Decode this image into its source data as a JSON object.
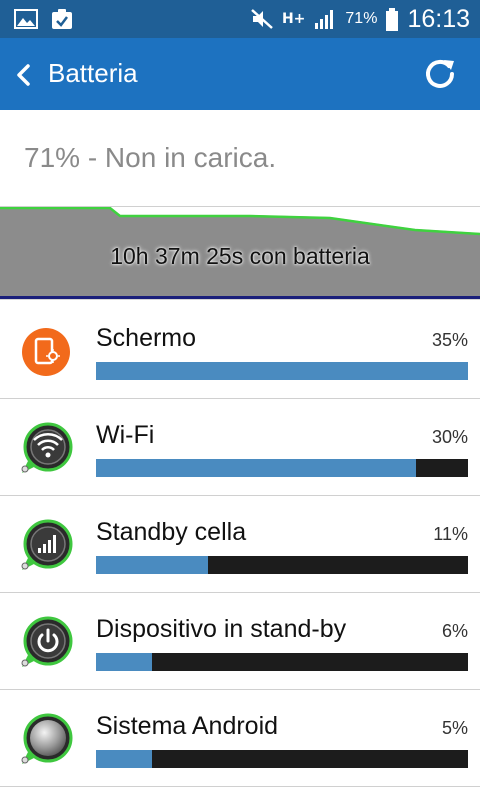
{
  "status_bar": {
    "battery_text": "71%",
    "time": "16:13",
    "network_type": "H+"
  },
  "header": {
    "title": "Batteria"
  },
  "battery": {
    "status_line": "71% - Non in carica.",
    "graph_label": "10h 37m 25s con batteria"
  },
  "usage": [
    {
      "name": "Schermo",
      "percent_label": "35%",
      "fill": 1.0,
      "icon": "screen-brightness-icon"
    },
    {
      "name": "Wi-Fi",
      "percent_label": "30%",
      "fill": 0.86,
      "icon": "wifi-icon"
    },
    {
      "name": "Standby cella",
      "percent_label": "11%",
      "fill": 0.3,
      "icon": "cell-signal-icon"
    },
    {
      "name": "Dispositivo in stand-by",
      "percent_label": "6%",
      "fill": 0.15,
      "icon": "power-icon"
    },
    {
      "name": "Sistema Android",
      "percent_label": "5%",
      "fill": 0.15,
      "icon": "android-system-icon"
    }
  ],
  "colors": {
    "status_bar": "#1f5f96",
    "action_bar": "#1d72c0",
    "bar_fill": "#4a8bc0",
    "bar_track": "#1c1c1c",
    "graph_line": "#3fd23f"
  }
}
